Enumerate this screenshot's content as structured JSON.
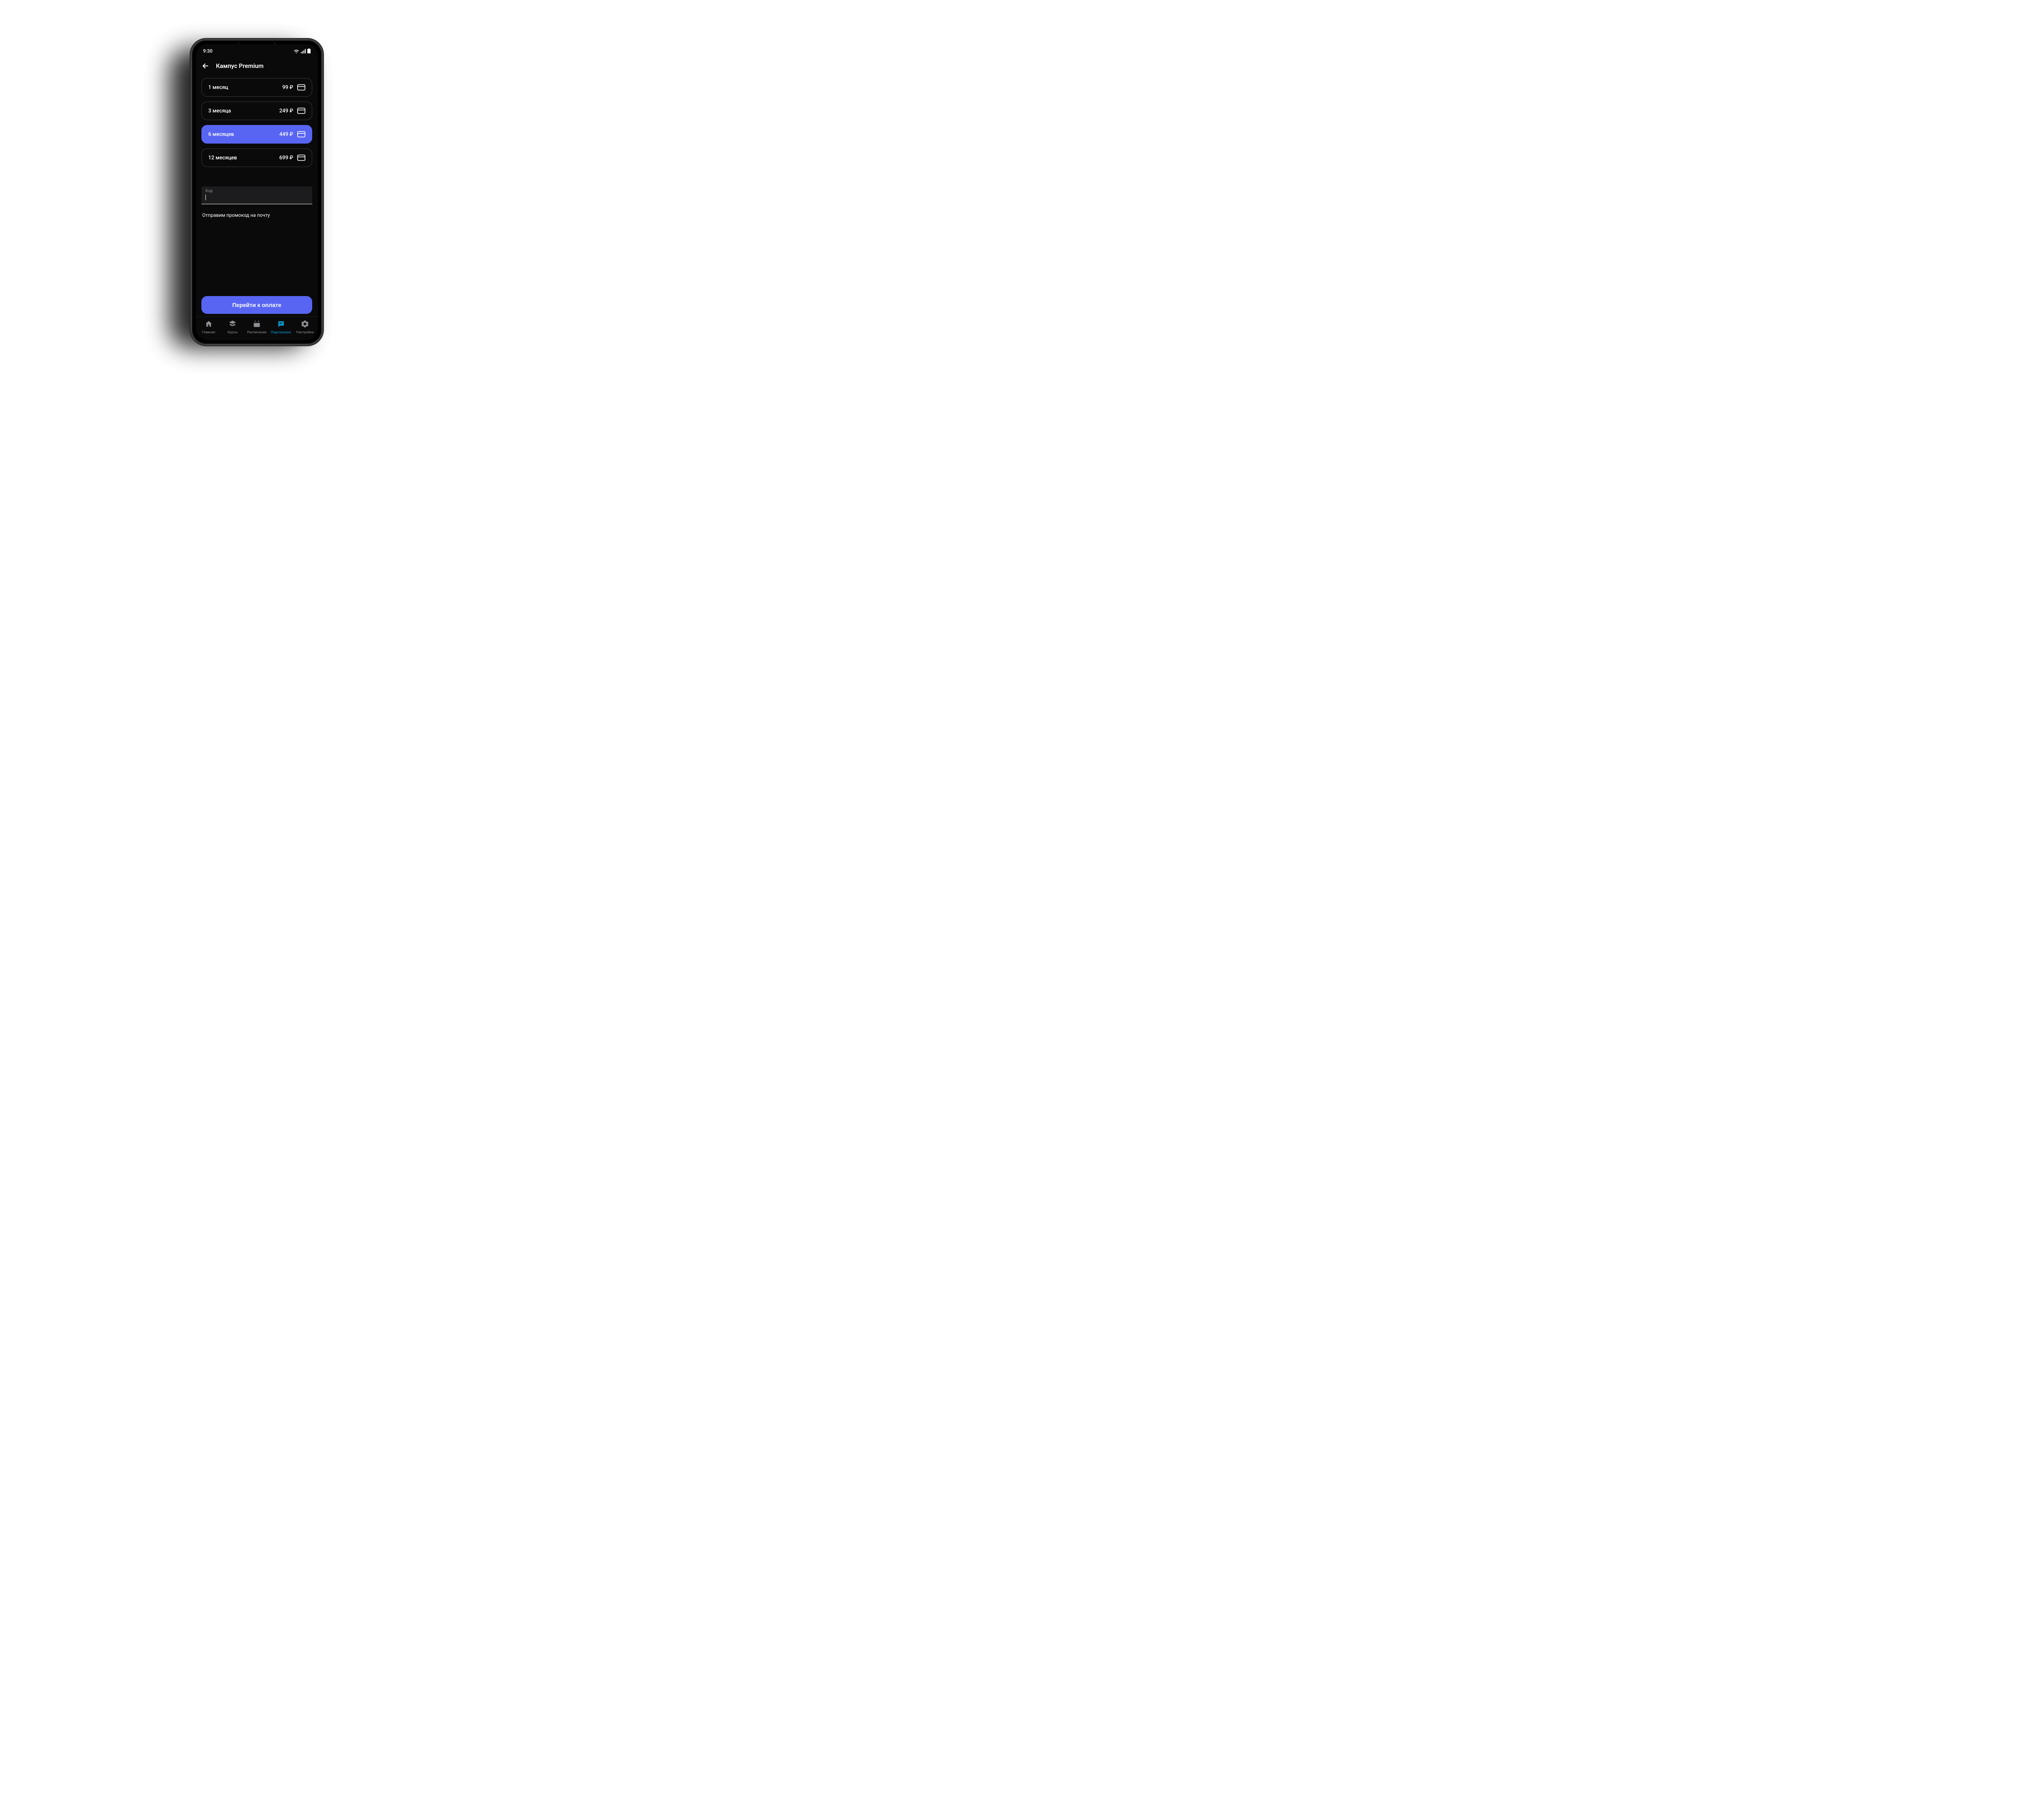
{
  "status": {
    "time": "9:30"
  },
  "header": {
    "title": "Кампус Premium"
  },
  "plans": [
    {
      "label": "1 месяц",
      "price": "99 ₽",
      "selected": false
    },
    {
      "label": "3 месяца",
      "price": "249 ₽",
      "selected": false
    },
    {
      "label": "6 месяцев",
      "price": "449 ₽",
      "selected": true
    },
    {
      "label": "12 месяцев",
      "price": "699 ₽",
      "selected": false
    }
  ],
  "promo": {
    "label": "Код",
    "value": "",
    "link": "Отправим промокод на почту"
  },
  "cta": {
    "label": "Перейти к оплате"
  },
  "tabs": [
    {
      "label": "Главная",
      "active": false
    },
    {
      "label": "Курсы",
      "active": false
    },
    {
      "label": "Расписание",
      "active": false
    },
    {
      "label": "Подслушано",
      "active": true
    },
    {
      "label": "Настройки",
      "active": false
    }
  ],
  "colors": {
    "accent": "#5865f2",
    "activeTab": "#0aa3d8"
  }
}
